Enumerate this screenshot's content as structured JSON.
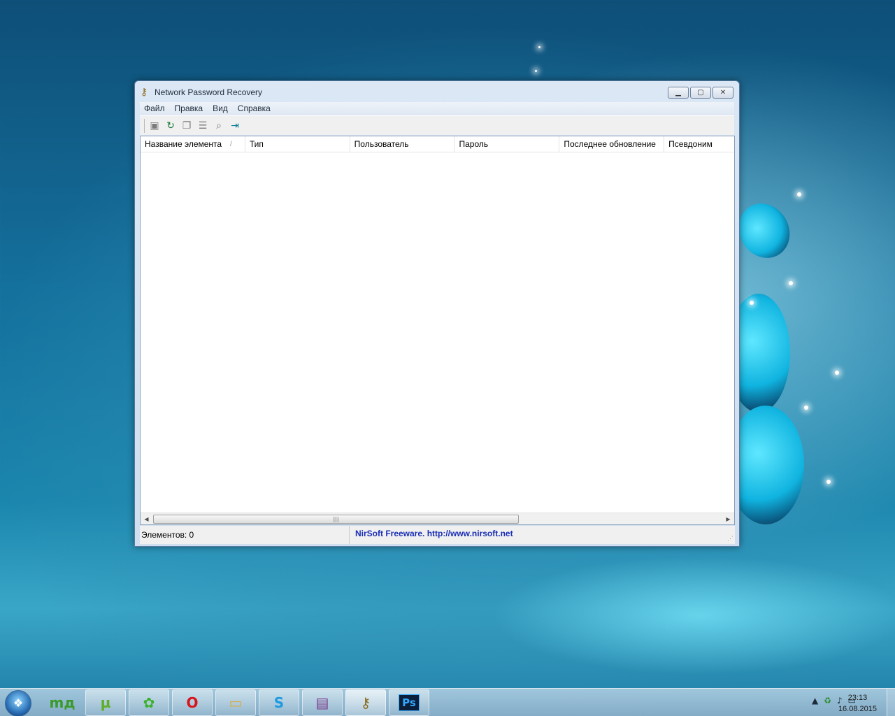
{
  "window": {
    "title": "Network Password Recovery",
    "app_icon": "keys-icon",
    "caption_buttons": [
      "minimize",
      "maximize",
      "close"
    ]
  },
  "menu": {
    "items": [
      "Файл",
      "Правка",
      "Вид",
      "Справка"
    ]
  },
  "toolbar": {
    "buttons": [
      "save-icon",
      "refresh-icon",
      "copy-icon",
      "properties-icon",
      "find-icon",
      "exit-icon"
    ]
  },
  "listview": {
    "columns": [
      "Название элемента",
      "Тип",
      "Пользователь",
      "Пароль",
      "Последнее обновление",
      "Псевдоним"
    ],
    "sort_indicator": "/",
    "rows": []
  },
  "statusbar": {
    "items_label": "Элементов: 0",
    "credit": "NirSoft Freeware.  http://www.nirsoft.net"
  },
  "taskbar": {
    "apps": [
      {
        "name": "mydi",
        "icon": "mydi-icon",
        "glyph": "mд"
      },
      {
        "name": "utorrent",
        "icon": "utorrent-icon",
        "glyph": "µ"
      },
      {
        "name": "icq",
        "icon": "icq-flower-icon",
        "glyph": "✿"
      },
      {
        "name": "opera",
        "icon": "opera-icon",
        "glyph": "O"
      },
      {
        "name": "explorer",
        "icon": "folder-icon",
        "glyph": "▭"
      },
      {
        "name": "skype",
        "icon": "skype-icon",
        "glyph": "S"
      },
      {
        "name": "winrar",
        "icon": "winrar-icon",
        "glyph": "▤"
      },
      {
        "name": "network-password-recovery",
        "icon": "keys-icon",
        "glyph": "⚷"
      },
      {
        "name": "photoshop",
        "icon": "photoshop-icon",
        "glyph": "Ps"
      }
    ],
    "tray_icons": [
      "show-hidden-icon",
      "network-icon",
      "volume-icon",
      "monitor-icon"
    ],
    "time": "23:13",
    "date": "16.08.2015"
  },
  "colors": {
    "credit_text": "#1a2fb5",
    "desktop": "#14709c"
  }
}
